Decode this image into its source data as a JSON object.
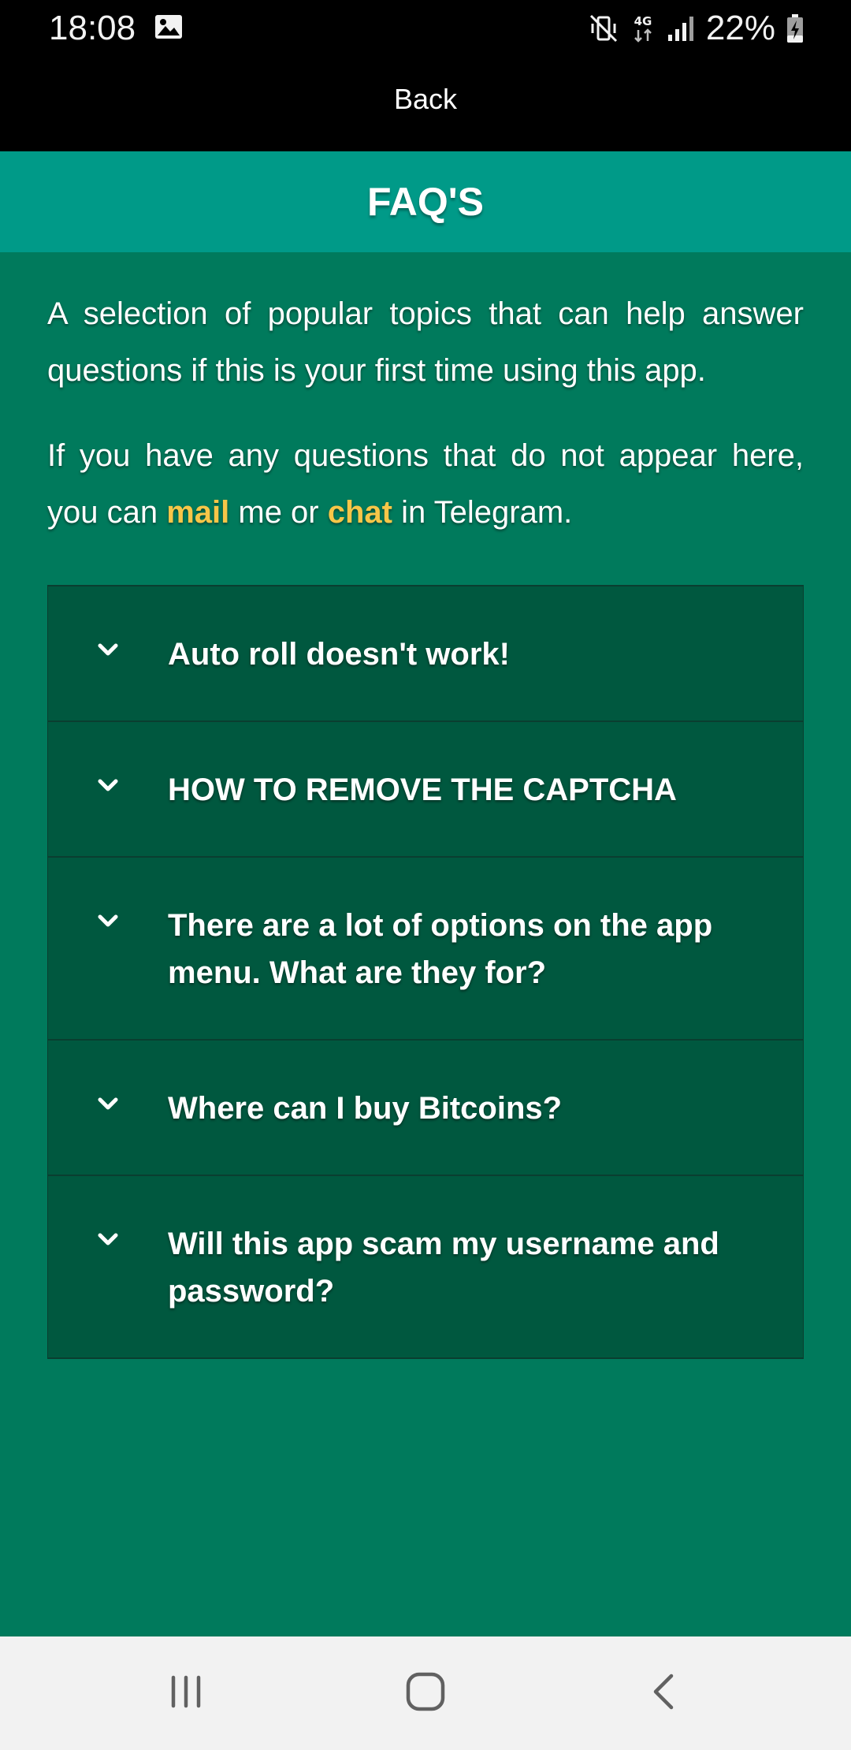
{
  "status_bar": {
    "time": "18:08",
    "network": "4G",
    "battery": "22%",
    "icons": [
      "image-icon",
      "mute-vibrate-icon",
      "4g-data-icon",
      "signal-icon",
      "battery-charging-icon"
    ]
  },
  "nav": {
    "back_label": "Back"
  },
  "header": {
    "title": "FAQ'S"
  },
  "intro": {
    "paragraph1": "A selection of popular topics that can help answer questions if this is your first time using this app.",
    "p2_before": "If you have any questions that do not appear here, you can ",
    "mail_link": "mail",
    "p2_middle": " me or ",
    "chat_link": "chat",
    "p2_after": " in Telegram."
  },
  "faq": {
    "items": [
      {
        "question": "Auto roll doesn't work!"
      },
      {
        "question": "HOW TO REMOVE THE CAPTCHA"
      },
      {
        "question": "There are a lot of options on the app menu. What are they for?"
      },
      {
        "question": "Where can I buy Bitcoins?"
      },
      {
        "question": "Will this app scam my username and password?"
      }
    ]
  },
  "colors": {
    "background": "#007a5c",
    "title_bar": "#009a88",
    "faq_item": "#00583f",
    "link": "#f7c648",
    "status_bar": "#000000",
    "nav_bar": "#f2f2f2"
  },
  "system_nav": {
    "icons": [
      "recent-apps-icon",
      "home-icon",
      "back-icon"
    ]
  }
}
